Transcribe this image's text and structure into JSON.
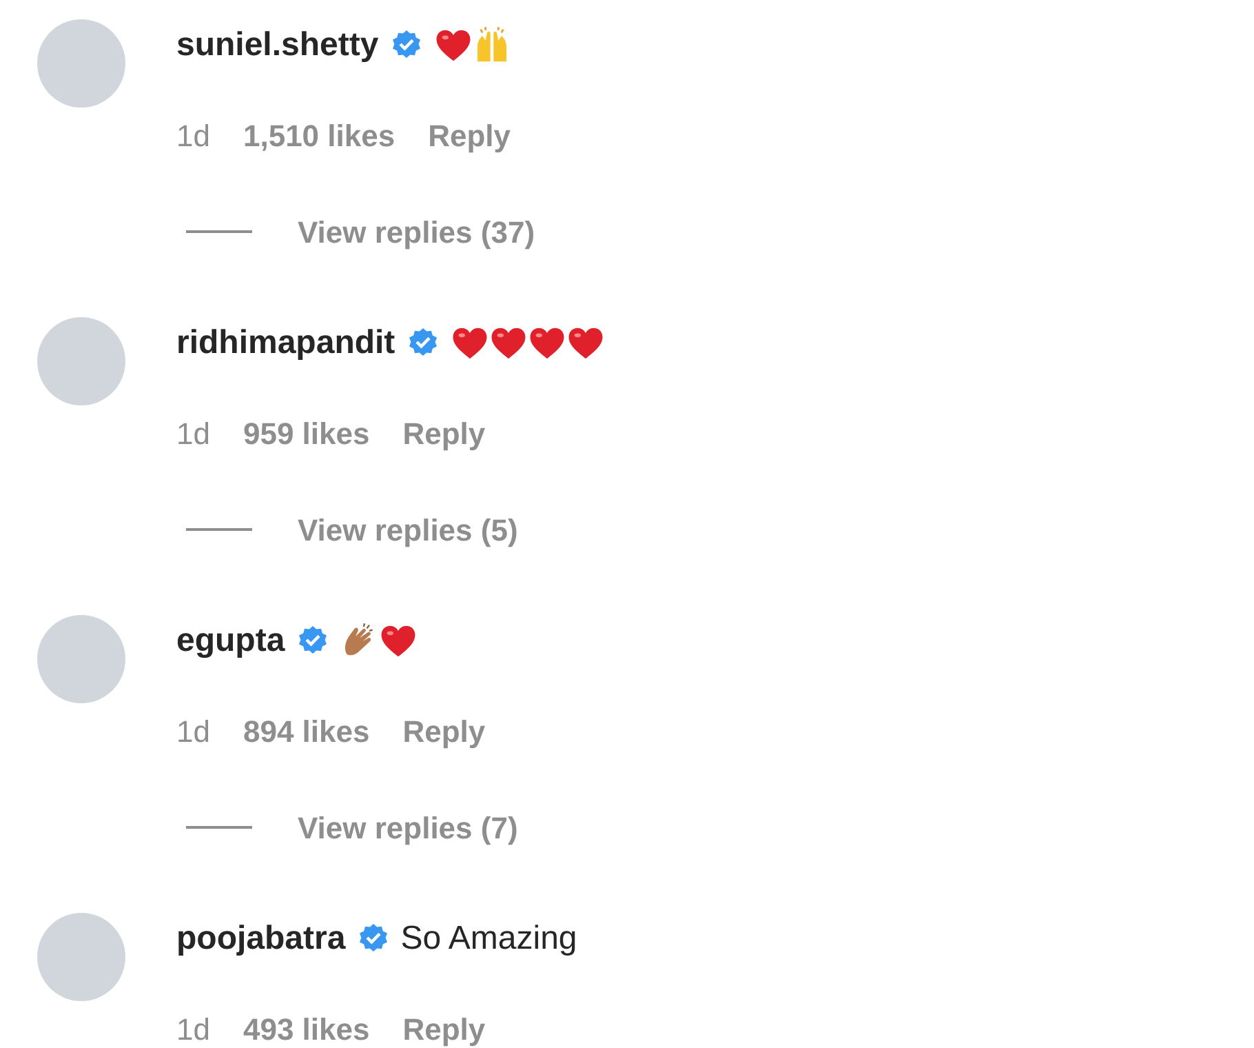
{
  "comments": [
    {
      "username": "suniel.shetty",
      "verified": true,
      "reactions": [
        {
          "kind": "heart"
        },
        {
          "kind": "raised-hands"
        }
      ],
      "time": "1d",
      "likes": "1,510 likes",
      "reply": "Reply",
      "view_replies": "View replies (37)"
    },
    {
      "username": "ridhimapandit",
      "verified": true,
      "reactions": [
        {
          "kind": "heart"
        },
        {
          "kind": "heart"
        },
        {
          "kind": "heart"
        },
        {
          "kind": "heart"
        }
      ],
      "time": "1d",
      "likes": "959 likes",
      "reply": "Reply",
      "view_replies": "View replies (5)"
    },
    {
      "username": "egupta",
      "verified": true,
      "reactions": [
        {
          "kind": "clap"
        },
        {
          "kind": "heart"
        }
      ],
      "time": "1d",
      "likes": "894 likes",
      "reply": "Reply",
      "view_replies": "View replies (7)"
    },
    {
      "username": "poojabatra",
      "verified": true,
      "text": "So Amazing",
      "time": "1d",
      "likes": "493 likes",
      "reply": "Reply"
    }
  ]
}
